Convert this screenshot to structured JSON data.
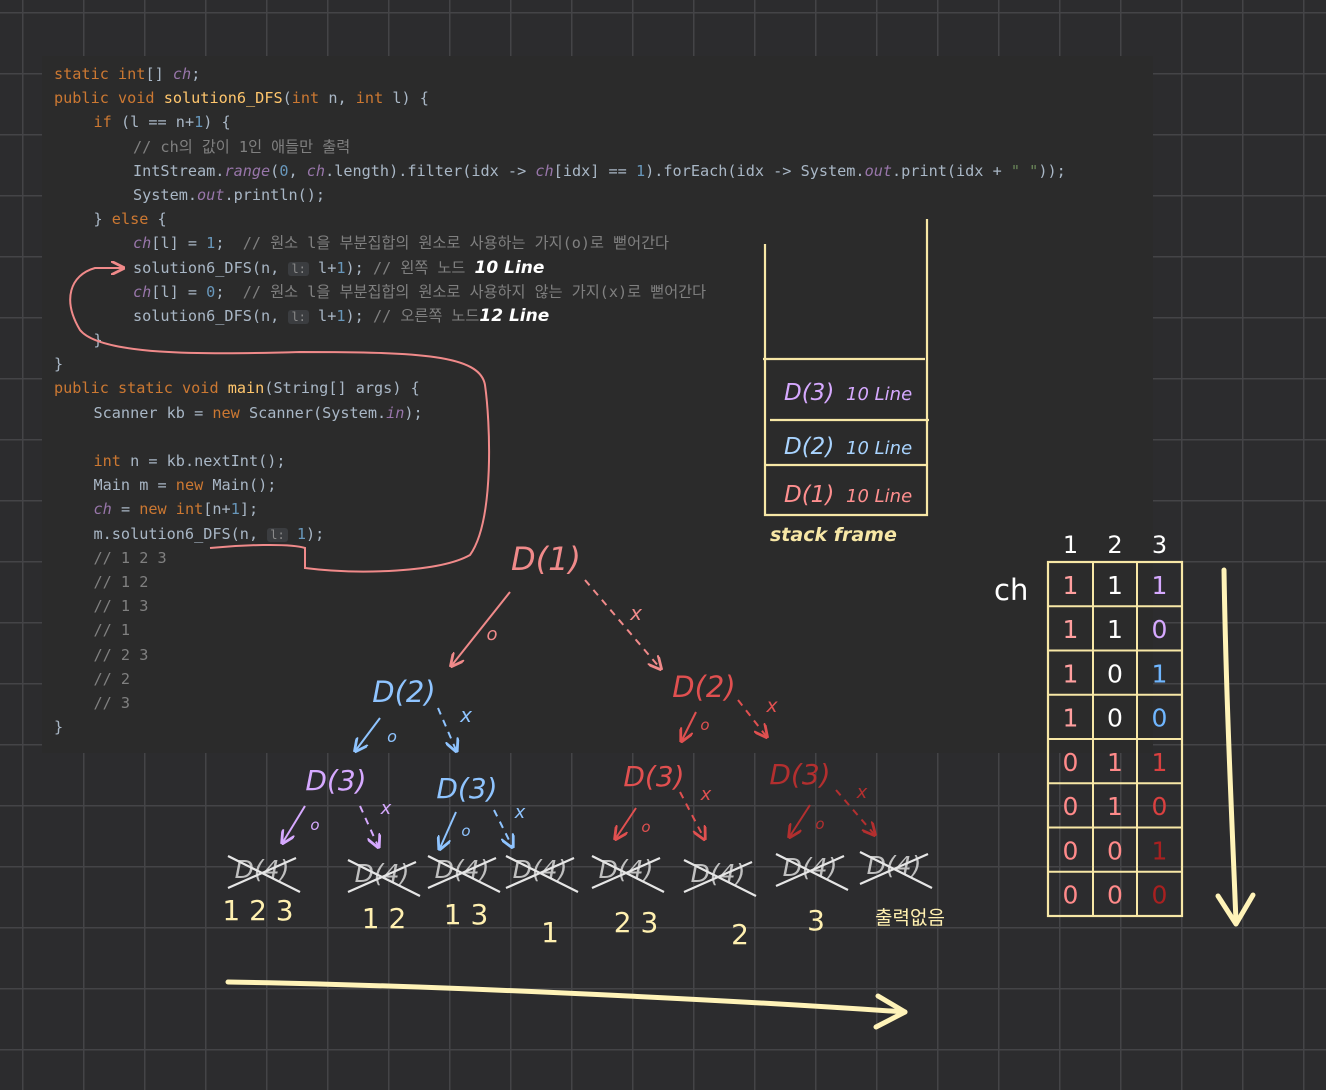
{
  "code": {
    "lines": [
      {
        "indent": 0,
        "parts": [
          {
            "c": "kw",
            "t": "static "
          },
          {
            "c": "kw",
            "t": "int"
          },
          {
            "t": "[] "
          },
          {
            "c": "it",
            "t": "ch"
          },
          {
            "t": ";"
          }
        ]
      },
      {
        "indent": 0,
        "parts": [
          {
            "c": "kw",
            "t": "public void "
          },
          {
            "c": "fn",
            "t": "solution6_DFS"
          },
          {
            "t": "("
          },
          {
            "c": "kw",
            "t": "int "
          },
          {
            "t": "n, "
          },
          {
            "c": "kw",
            "t": "int "
          },
          {
            "t": "l) {"
          }
        ]
      },
      {
        "indent": 1,
        "parts": [
          {
            "c": "kw",
            "t": "if "
          },
          {
            "t": "(l == n+"
          },
          {
            "c": "num",
            "t": "1"
          },
          {
            "t": ") {"
          }
        ]
      },
      {
        "indent": 2,
        "parts": [
          {
            "c": "cm",
            "t": "// ch의 값이 1인 애들만 출력"
          }
        ]
      },
      {
        "indent": 2,
        "parts": [
          {
            "t": "IntStream."
          },
          {
            "c": "it",
            "t": "range"
          },
          {
            "t": "("
          },
          {
            "c": "num",
            "t": "0"
          },
          {
            "t": ", "
          },
          {
            "c": "it",
            "t": "ch"
          },
          {
            "t": ".length).filter(idx -> "
          },
          {
            "c": "it",
            "t": "ch"
          },
          {
            "t": "[idx] == "
          },
          {
            "c": "num",
            "t": "1"
          },
          {
            "t": ").forEach(idx -> System."
          },
          {
            "c": "it",
            "t": "out"
          },
          {
            "t": ".print(idx + "
          },
          {
            "c": "str",
            "t": "\" \""
          },
          {
            "t": "));"
          }
        ]
      },
      {
        "indent": 2,
        "parts": [
          {
            "t": "System."
          },
          {
            "c": "it",
            "t": "out"
          },
          {
            "t": ".println();"
          }
        ]
      },
      {
        "indent": 1,
        "parts": [
          {
            "t": "} "
          },
          {
            "c": "kw",
            "t": "else "
          },
          {
            "t": "{"
          }
        ]
      },
      {
        "indent": 2,
        "parts": [
          {
            "c": "it",
            "t": "ch"
          },
          {
            "t": "[l] = "
          },
          {
            "c": "num",
            "t": "1"
          },
          {
            "t": ";  "
          },
          {
            "c": "cm",
            "t": "// 원소 l을 부분집합의 원소로 사용하는 가지(o)로 뻗어간다"
          }
        ]
      },
      {
        "indent": 2,
        "parts": [
          {
            "t": "solution6_DFS(n, "
          },
          {
            "c": "hint",
            "t": "l:"
          },
          {
            "t": " l+"
          },
          {
            "c": "num",
            "t": "1"
          },
          {
            "t": "); "
          },
          {
            "c": "cm",
            "t": "// 왼쪽 노드 "
          },
          {
            "c": "hw",
            "t": "10 Line"
          }
        ]
      },
      {
        "indent": 2,
        "parts": [
          {
            "c": "it",
            "t": "ch"
          },
          {
            "t": "[l] = "
          },
          {
            "c": "num",
            "t": "0"
          },
          {
            "t": ";  "
          },
          {
            "c": "cm",
            "t": "// 원소 l을 부분집합의 원소로 사용하지 않는 가지(x)로 뻗어간다"
          }
        ]
      },
      {
        "indent": 2,
        "parts": [
          {
            "t": "solution6_DFS(n, "
          },
          {
            "c": "hint",
            "t": "l:"
          },
          {
            "t": " l+"
          },
          {
            "c": "num",
            "t": "1"
          },
          {
            "t": "); "
          },
          {
            "c": "cm",
            "t": "// 오른쪽 노드"
          },
          {
            "c": "hw",
            "t": "12 Line"
          }
        ]
      },
      {
        "indent": 1,
        "parts": [
          {
            "t": "}"
          }
        ]
      },
      {
        "indent": 0,
        "parts": [
          {
            "t": "}"
          }
        ]
      },
      {
        "indent": 0,
        "parts": [
          {
            "c": "kw",
            "t": "public static void "
          },
          {
            "c": "fn",
            "t": "main"
          },
          {
            "t": "(String[] args) {"
          }
        ]
      },
      {
        "indent": 1,
        "parts": [
          {
            "t": "Scanner kb = "
          },
          {
            "c": "kw",
            "t": "new "
          },
          {
            "t": "Scanner(System."
          },
          {
            "c": "it",
            "t": "in"
          },
          {
            "t": ");"
          }
        ]
      },
      {
        "indent": 0,
        "parts": []
      },
      {
        "indent": 1,
        "parts": [
          {
            "c": "kw",
            "t": "int "
          },
          {
            "t": "n = kb.nextInt();"
          }
        ]
      },
      {
        "indent": 1,
        "parts": [
          {
            "t": "Main m = "
          },
          {
            "c": "kw",
            "t": "new "
          },
          {
            "t": "Main();"
          }
        ]
      },
      {
        "indent": 1,
        "parts": [
          {
            "c": "it",
            "t": "ch"
          },
          {
            "t": " = "
          },
          {
            "c": "kw",
            "t": "new int"
          },
          {
            "t": "[n+"
          },
          {
            "c": "num",
            "t": "1"
          },
          {
            "t": "];"
          }
        ]
      },
      {
        "indent": 1,
        "parts": [
          {
            "t": "m.solution6_DFS(n, "
          },
          {
            "c": "hint",
            "t": "l:"
          },
          {
            "t": " "
          },
          {
            "c": "num",
            "t": "1"
          },
          {
            "t": ");"
          }
        ]
      },
      {
        "indent": 1,
        "parts": [
          {
            "c": "cm",
            "t": "// 1 2 3"
          }
        ]
      },
      {
        "indent": 1,
        "parts": [
          {
            "c": "cm",
            "t": "// 1 2"
          }
        ]
      },
      {
        "indent": 1,
        "parts": [
          {
            "c": "cm",
            "t": "// 1 3"
          }
        ]
      },
      {
        "indent": 1,
        "parts": [
          {
            "c": "cm",
            "t": "// 1"
          }
        ]
      },
      {
        "indent": 1,
        "parts": [
          {
            "c": "cm",
            "t": "// 2 3"
          }
        ]
      },
      {
        "indent": 1,
        "parts": [
          {
            "c": "cm",
            "t": "// 2"
          }
        ]
      },
      {
        "indent": 1,
        "parts": [
          {
            "c": "cm",
            "t": "// 3"
          }
        ]
      },
      {
        "indent": 0,
        "parts": [
          {
            "t": "}"
          }
        ]
      }
    ]
  },
  "stack": {
    "frames": [
      {
        "label": "D(3)",
        "line": "10 Line",
        "color": "#d6a9ff"
      },
      {
        "label": "D(2)",
        "line": "10 Line",
        "color": "#a9d4ff"
      },
      {
        "label": "D(1)",
        "line": "10 Line",
        "color": "#ff8f8f"
      }
    ],
    "caption": "stack frame"
  },
  "tree": {
    "root": "D(1)",
    "level2": [
      "D(2)",
      "D(2)"
    ],
    "level3": [
      "D(3)",
      "D(3)",
      "D(3)",
      "D(3)"
    ],
    "leaf_label": "D(4)",
    "mark_o": "o",
    "mark_x": "x",
    "results": [
      "1 2 3",
      "1 2",
      "1 3",
      "1",
      "2 3",
      "2",
      "3",
      "출력없음"
    ]
  },
  "table": {
    "row_label": "ch",
    "headers": [
      "1",
      "2",
      "3"
    ],
    "rows": [
      [
        1,
        1,
        1
      ],
      [
        1,
        1,
        0
      ],
      [
        1,
        0,
        1
      ],
      [
        1,
        0,
        0
      ],
      [
        0,
        1,
        1
      ],
      [
        0,
        1,
        0
      ],
      [
        0,
        0,
        1
      ],
      [
        0,
        0,
        0
      ]
    ],
    "cell_colors": [
      [
        "#ff9f9f",
        "#ffffff",
        "#d6a9ff"
      ],
      [
        "#ff9f9f",
        "#ffffff",
        "#d6a9ff"
      ],
      [
        "#ff9f9f",
        "#ffffff",
        "#6fb6ff"
      ],
      [
        "#ff9f9f",
        "#ffffff",
        "#6fb6ff"
      ],
      [
        "#ff8a8a",
        "#ff8a8a",
        "#d94040"
      ],
      [
        "#ff8a8a",
        "#ff8a8a",
        "#d94040"
      ],
      [
        "#ff8a8a",
        "#ff8a8a",
        "#a82020"
      ],
      [
        "#ff8a8a",
        "#ff8a8a",
        "#a82020"
      ]
    ]
  },
  "colors": {
    "frame": "#f7e7a6",
    "arrow_pink": "#f08a8a",
    "purple": "#d6a9ff",
    "blue": "#8fc4ff",
    "red": "#e05050",
    "darkred": "#b32f2f",
    "result": "#fff0b0"
  }
}
